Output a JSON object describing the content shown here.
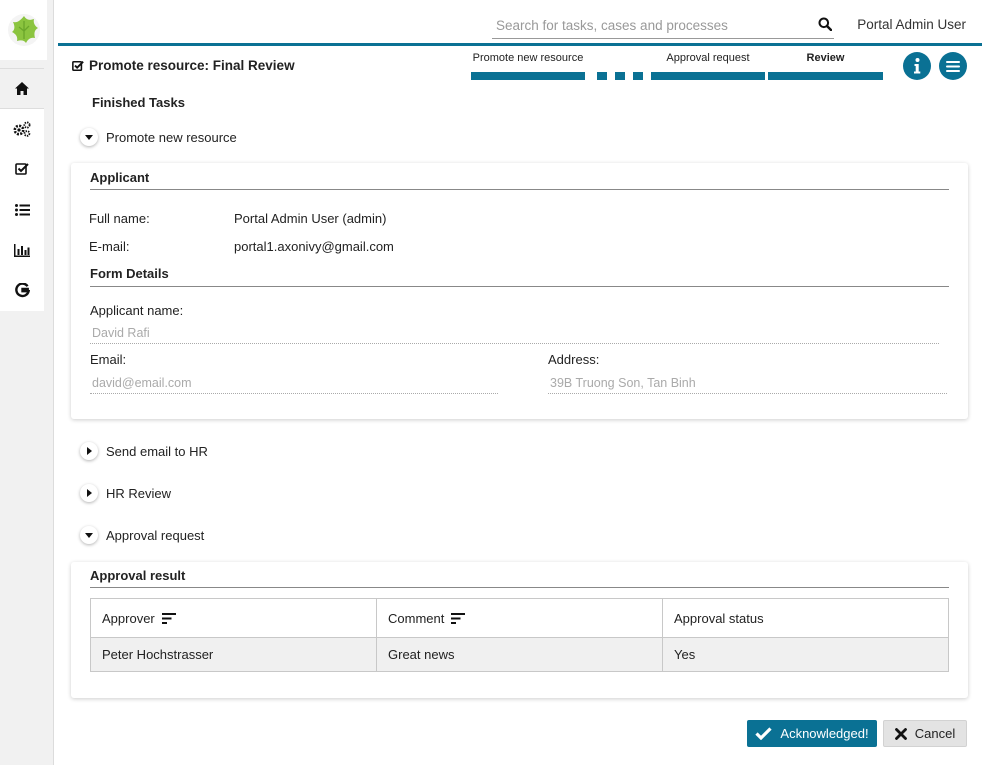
{
  "header": {
    "search_placeholder": "Search for tasks, cases and processes",
    "user_name": "Portal Admin User"
  },
  "sidebar": {
    "items": [
      {
        "icon": "home-icon"
      },
      {
        "icon": "gears-icon"
      },
      {
        "icon": "task-check-icon"
      },
      {
        "icon": "list-icon"
      },
      {
        "icon": "statistics-icon"
      },
      {
        "icon": "google-icon"
      }
    ]
  },
  "task": {
    "title": "Promote resource: Final Review"
  },
  "steps": [
    {
      "label": "Promote new resource",
      "current": false
    },
    {
      "label": "Approval request",
      "current": false
    },
    {
      "label": "Review",
      "current": true
    }
  ],
  "finished_tasks": {
    "title": "Finished Tasks",
    "items": [
      {
        "label": "Promote new resource",
        "expanded": true
      },
      {
        "label": "Send email to HR",
        "expanded": false
      },
      {
        "label": "HR Review",
        "expanded": false
      },
      {
        "label": "Approval request",
        "expanded": true
      }
    ]
  },
  "applicant_card": {
    "applicant_heading": "Applicant",
    "full_name_label": "Full name:",
    "full_name_value": "Portal Admin User (admin)",
    "email_label": "E-mail:",
    "email_value": "portal1.axonivy@gmail.com",
    "form_heading": "Form Details",
    "applicant_name_label": "Applicant name:",
    "applicant_name_value": "David Rafi",
    "form_email_label": "Email:",
    "form_email_value": "david@email.com",
    "address_label": "Address:",
    "address_value": "39B Truong Son, Tan Binh"
  },
  "approval_card": {
    "heading": "Approval result",
    "columns": [
      "Approver",
      "Comment",
      "Approval status"
    ],
    "rows": [
      [
        "Peter Hochstrasser",
        "Great news",
        "Yes"
      ]
    ]
  },
  "actions": {
    "acknowledge_label": "Acknowledged!",
    "cancel_label": "Cancel"
  },
  "colors": {
    "primary": "#0a7194",
    "logo_green": "#8bc43f"
  }
}
